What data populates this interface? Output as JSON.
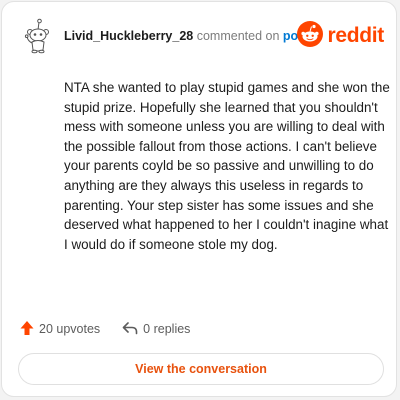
{
  "comment": {
    "username": "Livid_Huckleberry_28",
    "action_text": "commented on",
    "post_link_label": "post",
    "brand": "reddit",
    "body": "NTA she wanted to play stupid games and she won the stupid prize. Hopefully she learned that you shouldn't mess with someone unless you are willing to deal with the possible fallout from those actions. I can't believe your parents coyld be so passive and unwilling to do anything are they always this useless in regards to parenting. Your step sister has some issues and she deserved what happened to her I couldn't inagine what I would do if someone stole my dog.",
    "upvotes": "20 upvotes",
    "replies": "0 replies"
  },
  "cta": {
    "label": "View the conversation"
  },
  "icons": {
    "avatar": "snoo-avatar-icon",
    "logo": "reddit-snoo-icon",
    "upvote": "upvote-arrow-icon",
    "reply": "reply-arrow-icon"
  },
  "colors": {
    "brand_orange": "#ff4500",
    "link_blue": "#0079d3",
    "cta_text": "#e8520e",
    "username": "#1c1c1c",
    "muted": "#7c7c7c"
  }
}
